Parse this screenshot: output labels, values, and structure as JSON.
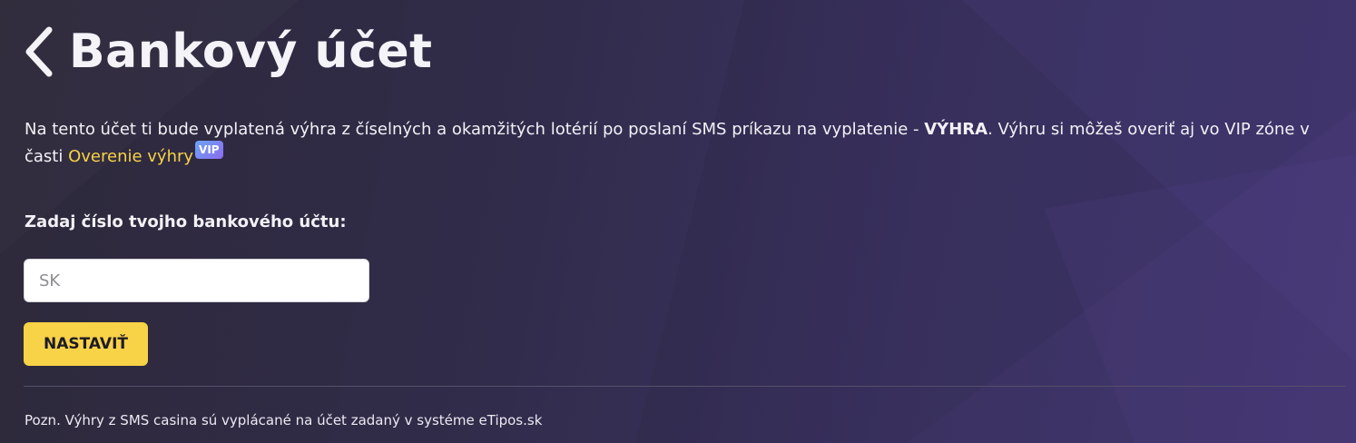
{
  "page": {
    "title": "Bankový účet",
    "back_icon": "chevron-left-icon"
  },
  "intro": {
    "text_before": "Na tento účet ti bude vyplatená výhra z číselných a okamžitých lotérií po poslaní SMS príkazu na vyplatenie - ",
    "keyword": "VÝHRA",
    "text_after": ". Výhru si môžeš overiť aj vo VIP zóne v časti ",
    "link_label": "Overenie výhry",
    "badge": "VIP"
  },
  "form": {
    "label": "Zadaj číslo tvojho bankového účtu:",
    "input_value": "",
    "input_placeholder": "SK",
    "submit_label": "NASTAVIŤ"
  },
  "footnote": "Pozn. Výhry z SMS casina sú vyplácané na účet zadaný v systéme eTipos.sk",
  "colors": {
    "accent": "#f8d247",
    "badge_gradient_start": "#6aa4f5",
    "badge_gradient_end": "#8b6cf0",
    "background": "#302b48"
  }
}
